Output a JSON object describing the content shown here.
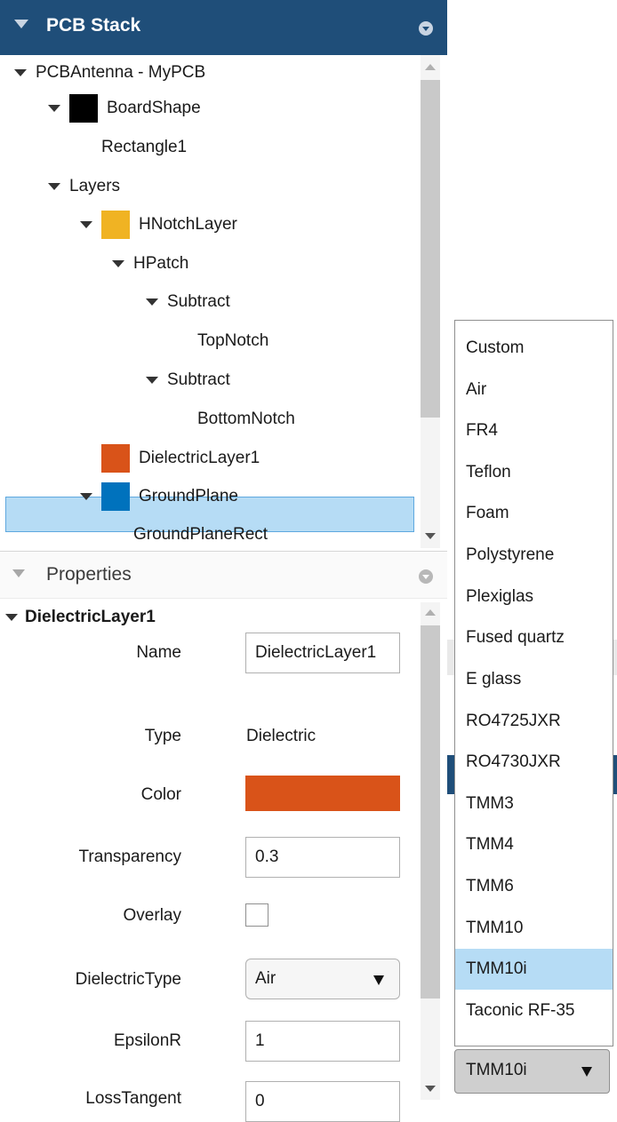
{
  "pcb_stack": {
    "title": "PCB Stack",
    "tree": {
      "root": "PCBAntenna - MyPCB",
      "board_shape": "BoardShape",
      "rectangle": "Rectangle1",
      "layers": "Layers",
      "hnotch_layer": "HNotchLayer",
      "hpatch": "HPatch",
      "subtract1": "Subtract",
      "top_notch": "TopNotch",
      "subtract2": "Subtract",
      "bottom_notch": "BottomNotch",
      "dielectric_layer": "DielectricLayer1",
      "ground_plane": "GroundPlane",
      "ground_plane_rect": "GroundPlaneRect"
    }
  },
  "properties": {
    "title": "Properties",
    "object": "DielectricLayer1",
    "fields": {
      "name_label": "Name",
      "name_value": "DielectricLayer1",
      "type_label": "Type",
      "type_value": "Dielectric",
      "color_label": "Color",
      "transparency_label": "Transparency",
      "transparency_value": "0.3",
      "overlay_label": "Overlay",
      "dielectric_type_label": "DielectricType",
      "dielectric_type_value": "Air",
      "epsilonr_label": "EpsilonR",
      "epsilonr_value": "1",
      "losstangent_label": "LossTangent",
      "losstangent_value": "0"
    }
  },
  "dropdown": {
    "options": [
      "Custom",
      "Air",
      "FR4",
      "Teflon",
      "Foam",
      "Polystyrene",
      "Plexiglas",
      "Fused quartz",
      "E glass",
      "RO4725JXR",
      "RO4730JXR",
      "TMM3",
      "TMM4",
      "TMM6",
      "TMM10",
      "TMM10i",
      "Taconic RF-35"
    ],
    "highlighted": "TMM10i",
    "selected_value": "TMM10i"
  },
  "colors": {
    "header_bg": "#1f4e79",
    "board_shape": "#000000",
    "hnotch_layer": "#f0b323",
    "dielectric_layer": "#d95319",
    "ground_plane": "#0072bd",
    "selection_bg": "#b6dcf5",
    "fourth_option_bg": "#1f4e79"
  }
}
